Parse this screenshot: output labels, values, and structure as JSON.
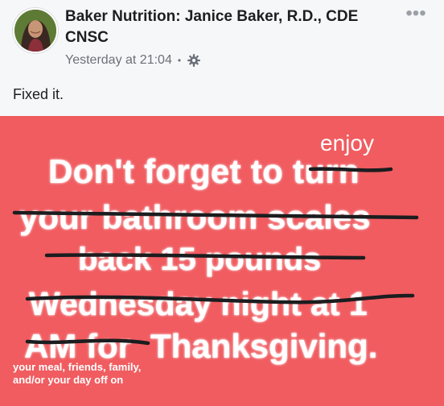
{
  "post": {
    "author": "Baker Nutrition: Janice Baker, R.D., CDE CNSC",
    "timestamp": "Yesterday at 21:04",
    "separator": "•",
    "privacy_icon": "gear-icon",
    "more_icon": "more-options-icon",
    "text": "Fixed it."
  },
  "image": {
    "background": "#f05c60",
    "lines": [
      "Don't forget to turn",
      "your bathroom scales",
      "back 15 pounds",
      "Wednesday night at 1",
      "AM for",
      "Thanksgiving."
    ],
    "handwritten_insert": "enjoy",
    "handwritten_note": "your meal, friends, family, and/or your day off on"
  }
}
